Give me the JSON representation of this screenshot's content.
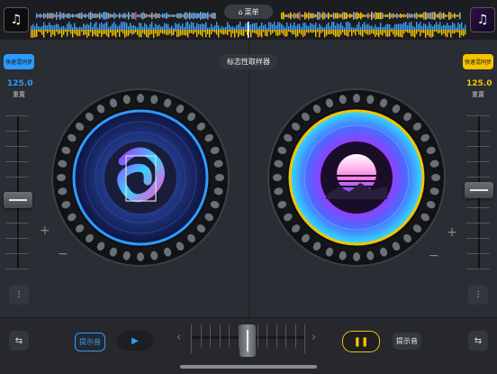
{
  "topbar": {
    "menu_label": "菜单",
    "left_thumb_icon": "music-note-icon",
    "right_thumb_icon": "music-note-icon"
  },
  "sampler": {
    "label": "标志性取样器"
  },
  "deck_left": {
    "sync_label": "快速混同步",
    "bpm": "125.0",
    "bpm_label": "重置",
    "accent": "#2e9bff",
    "cue_label": "提示音",
    "plus": "+",
    "minus": "−"
  },
  "deck_right": {
    "sync_label": "快速混同步",
    "bpm": "125.0",
    "bpm_label": "重置",
    "accent": "#f5c400",
    "cue_label": "提示音",
    "plus": "+",
    "minus": "−"
  },
  "colors": {
    "left_accent": "#2e9bff",
    "right_accent": "#f5c400",
    "background": "#2a2d33"
  }
}
